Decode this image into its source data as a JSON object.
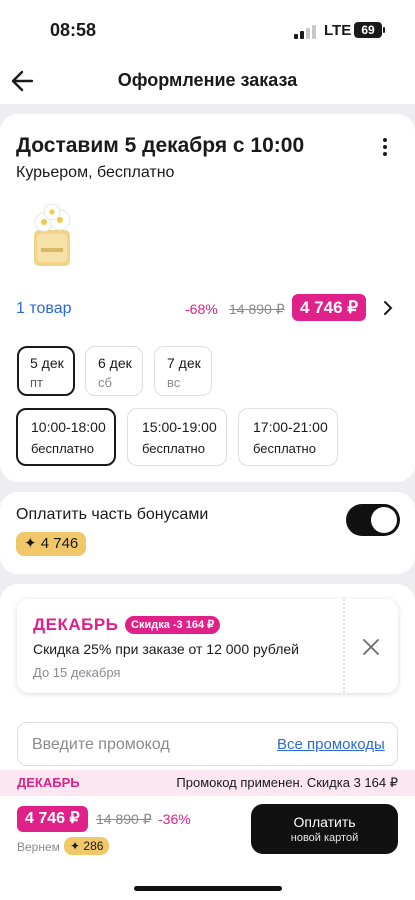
{
  "status_bar": {
    "time": "08:58",
    "network": "LTE",
    "battery": "69"
  },
  "header": {
    "title": "Оформление заказа",
    "back_icon": "arrow-left-icon"
  },
  "delivery": {
    "title": "Доставим 5 декабря с 10:00",
    "subtitle": "Курьером, бесплатно",
    "more_icon": "more-vertical-icon",
    "items_link": "1 товар",
    "discount": "-68%",
    "old_price": "14 890 ₽",
    "price": "4 746 ₽",
    "days": [
      {
        "date": "5 дек",
        "weekday": "пт",
        "selected": true
      },
      {
        "date": "6 дек",
        "weekday": "сб",
        "selected": false
      },
      {
        "date": "7 дек",
        "weekday": "вс",
        "selected": false
      }
    ],
    "slots": [
      {
        "time": "10:00-18:00",
        "cost": "бесплатно",
        "selected": true
      },
      {
        "time": "15:00-19:00",
        "cost": "бесплатно",
        "selected": false
      },
      {
        "time": "17:00-21:00",
        "cost": "бесплатно",
        "selected": false
      }
    ]
  },
  "bonus": {
    "title": "Оплатить часть бонусами",
    "amount": "✦ 4 746",
    "toggle_on": true
  },
  "promo": {
    "coupon_name": "ДЕКАБРЬ",
    "coupon_tag": "Скидка -3 164 ₽",
    "coupon_desc": "Скидка 25% при заказе от 12 000 рублей",
    "coupon_until": "До 15 декабря",
    "input_placeholder": "Введите промокод",
    "all_promos": "Все промокоды"
  },
  "applied": {
    "code": "ДЕКАБРЬ",
    "text": "Промокод применен. Скидка 3 164 ₽"
  },
  "footer": {
    "price": "4 746 ₽",
    "old_price": "14 890 ₽",
    "discount": "-36%",
    "return_label": "Вернем",
    "return_amount": "✦ 286",
    "pay_label": "Оплатить",
    "pay_sub": "новой картой"
  },
  "colors": {
    "accent": "#e0218a",
    "link": "#2a6bd8",
    "bonus": "#f0c86a",
    "dark": "#111111"
  }
}
